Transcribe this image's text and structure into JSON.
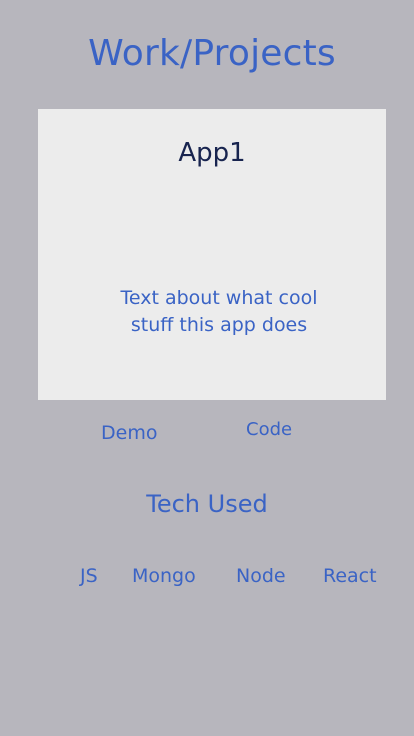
{
  "page": {
    "title": "Work/Projects"
  },
  "project": {
    "name": "App1",
    "description": "Text about what cool stuff this app does",
    "demo_label": "Demo",
    "code_label": "Code"
  },
  "tech": {
    "heading": "Tech Used",
    "items": [
      "JS",
      "Mongo",
      "Node",
      "React"
    ]
  },
  "colors": {
    "background": "#b7b6bd",
    "card": "#ececec",
    "accent": "#3a63c5",
    "card_title": "#18244f"
  }
}
